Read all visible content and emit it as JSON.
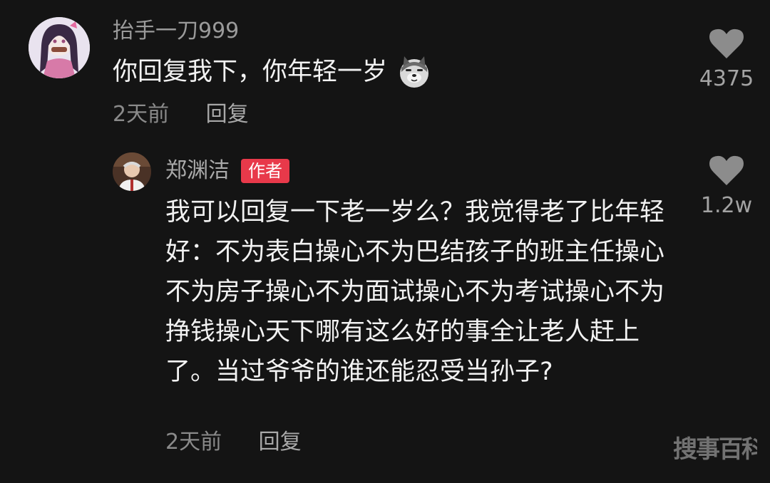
{
  "comment": {
    "username": "抬手一刀999",
    "text": "你回复我下，你年轻一岁",
    "emoji": "dog-emoji",
    "time": "2天前",
    "reply_label": "回复",
    "likes": "4375"
  },
  "reply": {
    "username": "郑渊洁",
    "badge": "作者",
    "text": "我可以回复一下老一岁么？我觉得老了比年轻好：不为表白操心不为巴结孩子的班主任操心不为房子操心不为面试操心不为考试操心不为挣钱操心天下哪有这么好的事全让老人赶上了。当过爷爷的谁还能忍受当孙子?",
    "time": "2天前",
    "reply_label": "回复",
    "likes": "1.2w"
  },
  "watermark": "搜事百科",
  "colors": {
    "background": "#141414",
    "badge": "#e8394a",
    "heart": "#8c8c8c"
  }
}
